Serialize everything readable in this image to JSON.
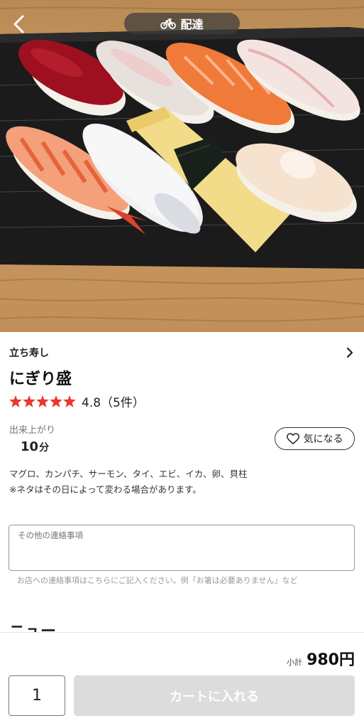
{
  "header": {
    "delivery_label": "配達",
    "back_icon": "back-arrow-icon",
    "delivery_icon": "bicycle-icon"
  },
  "hero": {
    "image_subject": "nigiri sushi assortment photo"
  },
  "shop": {
    "name": "立ち寿し",
    "chevron_icon": "chevron-right-icon"
  },
  "item": {
    "title": "にぎり盛",
    "rating": {
      "stars": 5,
      "text": "4.8（5件）",
      "star_color": "#e8382c"
    },
    "ready": {
      "label": "出来上がり",
      "value": "10",
      "unit": "分"
    },
    "favorite_label": "気になる",
    "description_line1": "マグロ、カンパチ、サーモン、タイ、エビ、イカ、卵、貝柱",
    "description_line2": "※ネタはその日によって変わる場合があります。"
  },
  "memo": {
    "placeholder": "その他の連絡事項",
    "help": "お店への連絡事項はこちらにご記入ください。例「お箸は必要ありません」など"
  },
  "next_section": {
    "heading_peek": "ニュー"
  },
  "footer": {
    "subtotal_label": "小計",
    "subtotal_value": "980円",
    "quantity": "1",
    "cart_label": "カートに入れる",
    "cart_color": "#dcdcdc"
  }
}
